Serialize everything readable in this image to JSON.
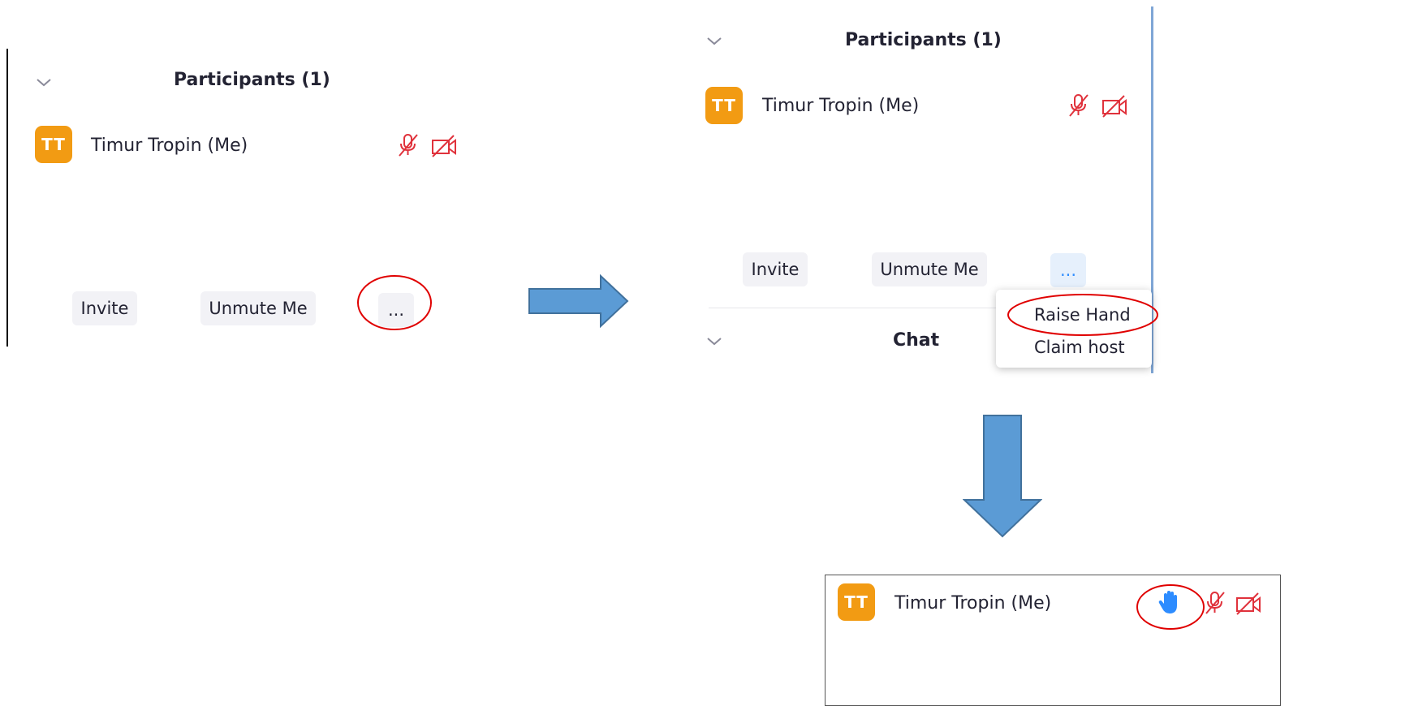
{
  "panel_before": {
    "section_title": "Participants (1)",
    "participant": {
      "initials": "TT",
      "name": "Timur Tropin (Me)"
    },
    "buttons": {
      "invite": "Invite",
      "unmute": "Unmute Me",
      "more": "..."
    }
  },
  "panel_menu_open": {
    "section_title": "Participants (1)",
    "participant": {
      "initials": "TT",
      "name": "Timur Tropin (Me)"
    },
    "buttons": {
      "invite": "Invite",
      "unmute": "Unmute Me",
      "more": "..."
    },
    "chat_title": "Chat",
    "menu": {
      "raise_hand": "Raise Hand",
      "claim_host": "Claim host"
    }
  },
  "panel_after": {
    "participant": {
      "initials": "TT",
      "name": "Timur Tropin (Me)"
    }
  },
  "icons": {
    "collapse": "chevron-down-icon",
    "muted_mic": "muted-microphone-icon",
    "video_off": "video-off-icon",
    "raised_hand": "raised-hand-icon",
    "step_arrow_right": "arrow-right-icon",
    "step_arrow_down": "arrow-down-icon",
    "highlight": "red-ellipse-highlight"
  },
  "colors": {
    "avatar": "#f29b13",
    "muted_icon": "#e0323c",
    "highlight": "#e00000",
    "arrow_fill": "#5b9bd5",
    "arrow_stroke": "#41719c",
    "hand": "#2d8cff",
    "more_button_active": "#e6f0fc"
  }
}
